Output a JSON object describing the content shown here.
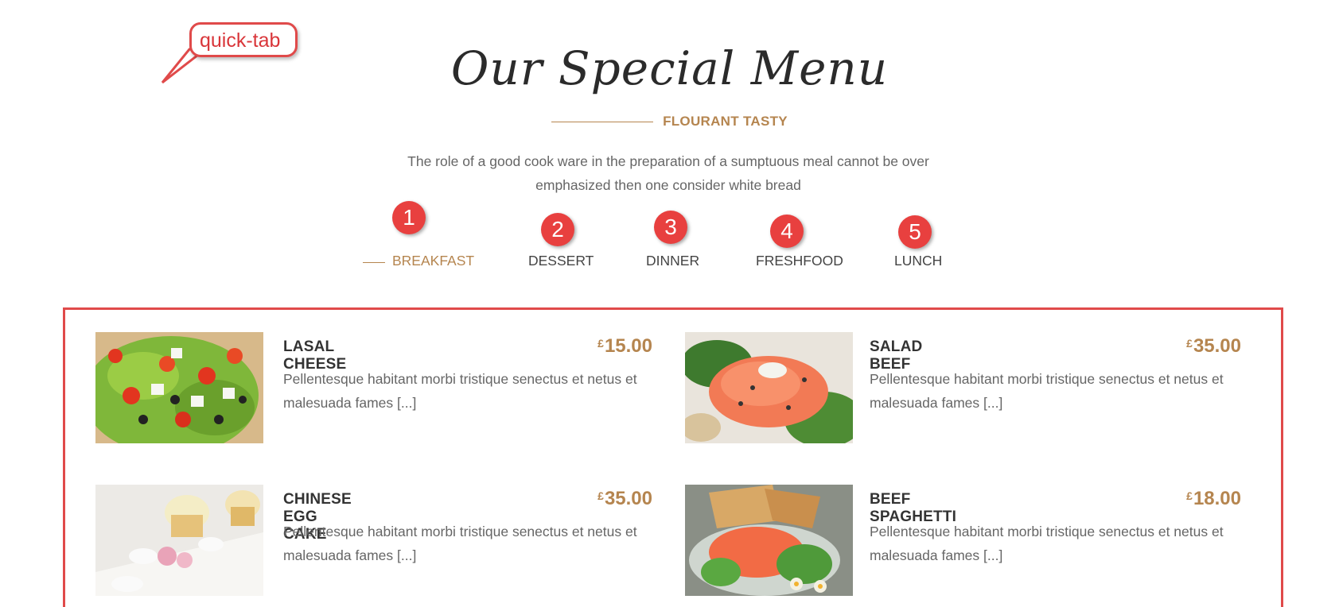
{
  "annotation": {
    "callout_text": "quick-tab"
  },
  "header": {
    "title": "Our Special Menu",
    "subtitle": "FLOURANT TASTY",
    "description": "The role of a good cook ware in the preparation of a sumptuous meal cannot be over emphasized then one consider white bread"
  },
  "tabs": [
    {
      "label": "BREAKFAST",
      "badge": "1",
      "active": true
    },
    {
      "label": "DESSERT",
      "badge": "2",
      "active": false
    },
    {
      "label": "DINNER",
      "badge": "3",
      "active": false
    },
    {
      "label": "FRESHFOOD",
      "badge": "4",
      "active": false
    },
    {
      "label": "LUNCH",
      "badge": "5",
      "active": false
    }
  ],
  "menu_items": [
    {
      "name": "LASAL CHEESE",
      "currency": "£",
      "price": "15.00",
      "description": "Pellentesque habitant morbi tristique senectus et netus et malesuada fames [...]",
      "image": "greek-salad-photo"
    },
    {
      "name": "SALAD BEEF",
      "currency": "£",
      "price": "35.00",
      "description": "Pellentesque habitant morbi tristique senectus et netus et malesuada fames [...]",
      "image": "salmon-salad-photo"
    },
    {
      "name": "CHINESE EGG CAKE",
      "currency": "£",
      "price": "35.00",
      "description": "Pellentesque habitant morbi tristique senectus et netus et malesuada fames [...]",
      "image": "cupcake-dessert-photo"
    },
    {
      "name": "BEEF SPAGHETTI",
      "currency": "£",
      "price": "18.00",
      "description": "Pellentesque habitant morbi tristique senectus et netus et malesuada fames [...]",
      "image": "salmon-toast-photo"
    }
  ],
  "colors": {
    "accent": "#b5854f",
    "annotation_red": "#e04a4a",
    "badge_red": "#e8403f"
  }
}
